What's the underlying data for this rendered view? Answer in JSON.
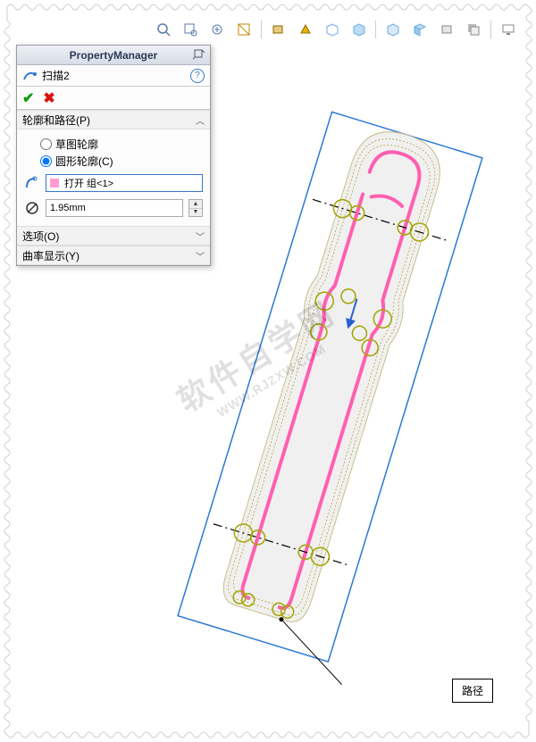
{
  "toolbar_icons": [
    "zoom-fit-icon",
    "zoom-area-icon",
    "zoom-prev-icon",
    "section-view-icon",
    "view-orientation-icon",
    "display-style-icon",
    "hide-show-icon",
    "appearance-icon",
    "scene-icon",
    "render-icon",
    "draft-icon",
    "shadow-icon",
    "screen-icon"
  ],
  "panel": {
    "title": "PropertyManager",
    "feature_name": "扫描2",
    "section_profile_path": "轮廓和路径(P)",
    "radio_sketch": "草图轮廓",
    "radio_circle": "圆形轮廓(C)",
    "selection_value": "打开 组<1>",
    "diameter_value": "1.95mm",
    "section_options": "选项(O)",
    "section_curvature": "曲率显示(Y)"
  },
  "callout_label": "路径",
  "watermark_main": "软件自学网",
  "watermark_sub": "WWW.RJZXW.COM",
  "colors": {
    "pink": "#ff5fb1",
    "guide": "#b9a33a",
    "box": "#2b78d4",
    "blue": "#2b5fd4"
  }
}
